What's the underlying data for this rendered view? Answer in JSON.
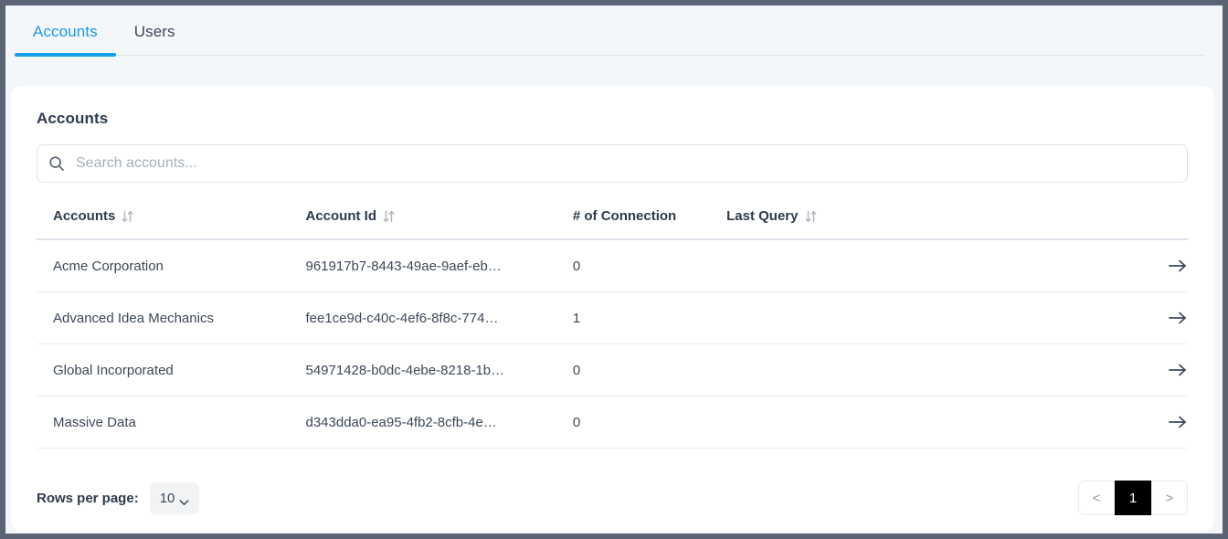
{
  "tabs": [
    {
      "label": "Accounts",
      "active": true
    },
    {
      "label": "Users",
      "active": false
    }
  ],
  "page": {
    "title": "Accounts"
  },
  "search": {
    "placeholder": "Search accounts...",
    "value": "",
    "icon": "search-icon"
  },
  "table": {
    "columns": [
      {
        "label": "Accounts",
        "sortable": true
      },
      {
        "label": "Account Id",
        "sortable": true
      },
      {
        "label": "# of Connection",
        "sortable": false
      },
      {
        "label": "Last Query",
        "sortable": true
      },
      {
        "label": "",
        "sortable": false
      }
    ],
    "rows": [
      {
        "name": "Acme Corporation",
        "account_id": "961917b7-8443-49ae-9aef-eb…",
        "connections": "0",
        "last_query": "",
        "action_icon": "arrow-right-icon"
      },
      {
        "name": "Advanced Idea Mechanics",
        "account_id": "fee1ce9d-c40c-4ef6-8f8c-774…",
        "connections": "1",
        "last_query": "",
        "action_icon": "arrow-right-icon"
      },
      {
        "name": "Global Incorporated",
        "account_id": "54971428-b0dc-4ebe-8218-1b…",
        "connections": "0",
        "last_query": "",
        "action_icon": "arrow-right-icon"
      },
      {
        "name": "Massive Data",
        "account_id": "d343dda0-ea95-4fb2-8cfb-4e…",
        "connections": "0",
        "last_query": "",
        "action_icon": "arrow-right-icon"
      }
    ]
  },
  "footer": {
    "rows_per_page_label": "Rows per page:",
    "rows_per_page_value": "10",
    "pagination": {
      "prev_label": "<",
      "next_label": ">",
      "current_page": "1"
    }
  },
  "colors": {
    "accent": "#14a0ed",
    "active_tab_text": "#1a9ae6",
    "text": "#3c4858",
    "heading": "#2e3a4d",
    "frame": "#5b6475",
    "page_bg": "#f4f7fa",
    "card_bg": "#ffffff",
    "pager_active_bg": "#000000"
  }
}
